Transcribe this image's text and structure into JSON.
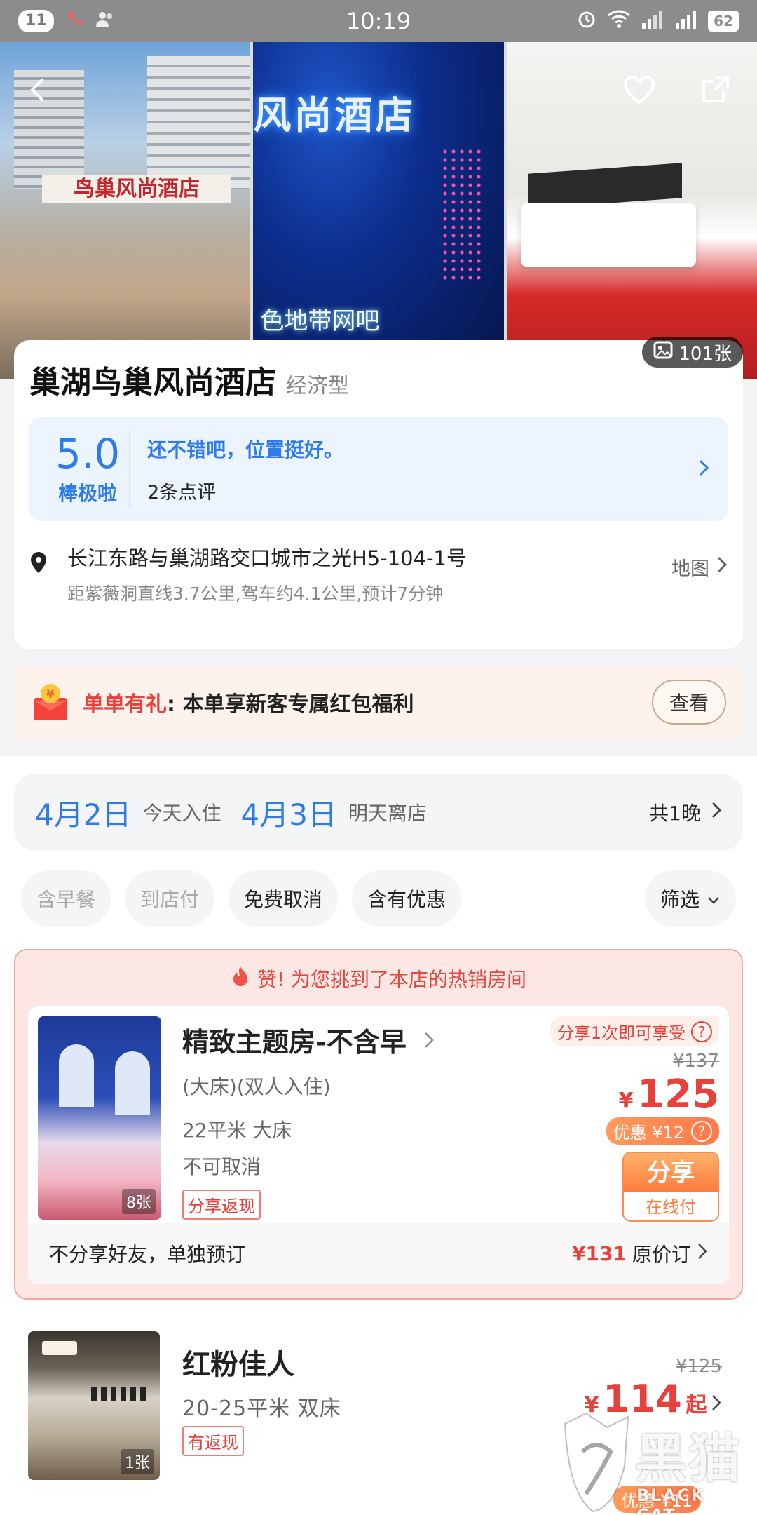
{
  "status_bar": {
    "notif_count": "11",
    "time": "10:19",
    "battery": "62"
  },
  "hero": {
    "photo_count": "101张",
    "photo1_sign": "鸟巢风尚酒店",
    "photo2_sign": "风尚酒店",
    "photo2_bottom": "色地带网吧"
  },
  "hotel": {
    "name": "巢湖鸟巢风尚酒店",
    "type": "经济型",
    "score": "5.0",
    "score_label": "棒极啦",
    "review_highlight": "还不错吧，位置挺好。",
    "review_count": "2条点评",
    "address": "长江东路与巢湖路交口城市之光H5-104-1号",
    "distance": "距紫薇洞直线3.7公里,驾车约4.1公里,预计7分钟",
    "map_label": "地图"
  },
  "promo": {
    "highlight": "单单有礼",
    "text": ": 本单享新客专属红包福利",
    "button": "查看"
  },
  "dates": {
    "checkin_date": "4月2日",
    "checkin_label": "今天入住",
    "checkout_date": "4月3日",
    "checkout_label": "明天离店",
    "nights": "共1晚"
  },
  "filters": {
    "items": [
      "含早餐",
      "到店付",
      "免费取消",
      "含有优惠"
    ],
    "filter_label": "筛选"
  },
  "hot_room": {
    "banner": "赞! 为您挑到了本店的热销房间",
    "name": "精致主题房-不含早",
    "bed_note": "(大床)(双人入住)",
    "size_bed": "22平米 大床",
    "cancel": "不可取消",
    "tag": "分享返现",
    "img_count": "8张",
    "share_tip": "分享1次即可享受",
    "old_price": "¥137",
    "currency": "¥",
    "price": "125",
    "discount": "优惠 ¥12",
    "share_btn_top": "分享",
    "share_btn_bottom": "在线付",
    "solo_text": "不分享好友，单独预订",
    "solo_price": "¥131",
    "solo_suffix": "原价订"
  },
  "room2": {
    "name": "红粉佳人",
    "size_bed": "20-25平米  双床",
    "tag": "有返现",
    "img_count": "1张",
    "old_price": "¥125",
    "currency": "¥",
    "price": "114",
    "price_suffix": "起",
    "discount": "优惠 ¥11"
  },
  "watermark": {
    "text": "黑猫",
    "sub": "BLACK CAT"
  }
}
